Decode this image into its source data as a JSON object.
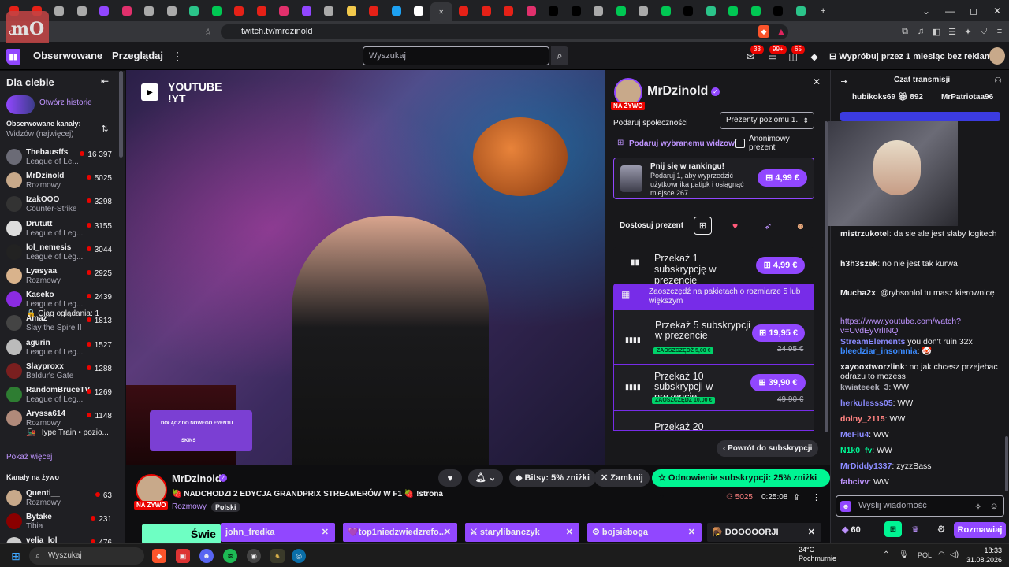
{
  "browser": {
    "url": "twitch.tv/mrdzinold",
    "tab_colors": [
      "#e62117",
      "#e62117",
      "#aaaaaa",
      "#aaaaaa",
      "#9146ff",
      "#e1306c",
      "#aaaaaa",
      "#aaaaaa",
      "#2bc48a",
      "#00c853",
      "#e62117",
      "#e62117",
      "#e1306c",
      "#9146ff",
      "#aaaaaa",
      "#f2c94c",
      "#e62117",
      "#1da1f2",
      "#ffffff",
      "#e1306c",
      "#e62117",
      "#e62117",
      "#e62117",
      "#e1306c",
      "#000000",
      "#000000",
      "#aaaaaa",
      "#00c853",
      "#aaaaaa",
      "#00c853",
      "#000000",
      "#2bc48a",
      "#00c853",
      "#00c853",
      "#000000",
      "#2bc48a"
    ],
    "active_tab_index": 19
  },
  "twitch": {
    "nav": {
      "followed": "Obserwowane",
      "browse": "Przeglądaj"
    },
    "search_placeholder": "Wyszukaj",
    "badges": {
      "drops": "33",
      "notifications": "99+",
      "whispers": "65"
    },
    "turbo_promo": "Wypróbuj przez 1 miesiąc bez reklam"
  },
  "sidebar": {
    "title": "Dla ciebie",
    "stories": "Otwórz historie",
    "followed_header": "Obserwowane kanały:",
    "sort": "Widzów (najwięcej)",
    "followed": [
      {
        "name": "Thebausffs",
        "game": "League of Le...",
        "viewers": "16 397",
        "color": "#6b6b76"
      },
      {
        "name": "MrDzinold",
        "game": "Rozmowy",
        "viewers": "5025",
        "color": "#c8a98a"
      },
      {
        "name": "IzakOOO",
        "game": "Counter-Strike",
        "viewers": "3298",
        "color": "#333333"
      },
      {
        "name": "Drututt",
        "game": "League of Leg...",
        "viewers": "3155",
        "color": "#dddddd"
      },
      {
        "name": "lol_nemesis",
        "game": "League of Leg...",
        "viewers": "3044",
        "color": "#222222"
      },
      {
        "name": "Lyasyaa",
        "game": "Rozmowy",
        "viewers": "2925",
        "color": "#d9b38c"
      },
      {
        "name": "Kaseko",
        "game": "League of Leg...",
        "extra": "🔒 Ciąg oglądania: 1",
        "viewers": "2439",
        "color": "#8a2be2"
      },
      {
        "name": "Amaz",
        "game": "Slay the Spire II",
        "viewers": "1813",
        "color": "#444444"
      },
      {
        "name": "agurin",
        "game": "League of Leg...",
        "viewers": "1527",
        "color": "#bbbbbb"
      },
      {
        "name": "Slayproxx",
        "game": "Baldur's Gate",
        "viewers": "1288",
        "color": "#7a1f1f"
      },
      {
        "name": "RandomBruceTV",
        "game": "League of Leg...",
        "viewers": "1269",
        "color": "#2e7d32"
      },
      {
        "name": "Aryssa614",
        "game": "Rozmowy",
        "extra": "🚂 Hype Train • pozio...",
        "viewers": "1148",
        "color": "#b08a7a"
      }
    ],
    "show_more": "Pokaż więcej",
    "live_header": "Kanały na żywo",
    "live": [
      {
        "name": "Quenti__",
        "game": "Rozmowy",
        "viewers": "63",
        "color": "#c8a98a"
      },
      {
        "name": "Bytake",
        "game": "Tibia",
        "viewers": "231",
        "color": "#8b0000"
      },
      {
        "name": "velia_lol",
        "game": "",
        "viewers": "476",
        "color": "#cccccc"
      }
    ]
  },
  "video": {
    "overlay_youtube": "YOUTUBE",
    "overlay_handle": "!YT",
    "overlay_event": "DOŁĄCZ DO NOWEGO EVENTU",
    "overlay_brand": "SKINS"
  },
  "gift": {
    "channel": "MrDzinold",
    "live": "NA ŻYWO",
    "community": "Podaruj społeczności",
    "tier": "Prezenty poziomu 1.",
    "gift_viewer": "Podaruj wybranemu widzowi",
    "anonymous": "Anonimowy prezent",
    "ranking": {
      "title": "Pnij się w rankingu!",
      "text": "Podaruj 1, aby wyprzedzić użytkownika patipk i osiągnąć miejsce 267",
      "price": "4,99 €"
    },
    "customize": "Dostosuj prezent",
    "bundle_banner": "Zaoszczędź na pakietach o rozmiarze 5 lub większym",
    "options": [
      {
        "label": "Przekaż 1 subskrypcję w prezencie",
        "price": "4,99 €"
      },
      {
        "label": "Przekaż 5 subskrypcji w prezencie",
        "price": "19,95 €",
        "old_price": "24,95 €",
        "save": "ZAOSZCZĘDŹ 5,00 €"
      },
      {
        "label": "Przekaż 10 subskrypcji w prezencie",
        "price": "39,90 €",
        "old_price": "49,90 €",
        "save": "ZAOSZCZĘDŹ 10,00 €"
      },
      {
        "label": "Przekaż 20"
      }
    ],
    "back": "Powrót do subskrypcji"
  },
  "stream": {
    "name": "MrDzinold",
    "live": "NA ŻYWO",
    "title": "🍓 NADCHODZI 2 EDYCJA GRANDPRIX STREAMERÓW W F1 🍓 !strona",
    "category": "Rozmowy",
    "language": "Polski",
    "bits": "Bitsy: 5% zniżki",
    "close": "Zamknij",
    "resub": "Odnowienie subskrypcji: 25% zniżki",
    "viewers": "5025",
    "uptime": "0:25:08"
  },
  "tabs": {
    "event": "Świe",
    "pinned": [
      {
        "label": "john_fredka",
        "color": "#9147ff"
      },
      {
        "label": "💜top1niedzwiedzrefo...",
        "color": "#9147ff"
      },
      {
        "label": "⚔ starylibanczyk",
        "color": "#9147ff"
      },
      {
        "label": "⚙ bojsieboga",
        "color": "#9147ff"
      },
      {
        "label": "🪤 DOOOOORJI",
        "color": "#1f1f23"
      }
    ]
  },
  "chat": {
    "title": "Czat transmisji",
    "top": [
      {
        "name": "hubikoks69",
        "count": "892"
      },
      {
        "name": "MrPatriotaa96"
      }
    ],
    "lines": [
      {
        "user": "mistrzukotel",
        "color": "#efeff1",
        "text": ": da sie ale jest słaby logitech"
      },
      {
        "user": "h3h3szek",
        "color": "#efeff1",
        "text": ": no nie jest tak kurwa"
      },
      {
        "user": "Mucha2x",
        "color": "#efeff1",
        "text": ": @rybsonlol tu masz kierownicę"
      },
      {
        "user": "",
        "color": "#bf94ff",
        "text": "https://www.youtube.com/watch?v=UvdEyVrlINQ"
      },
      {
        "user": "StreamElements",
        "color": "#8b8bff",
        "text": " you don't ruin 32x"
      },
      {
        "user": "bleedziar_insomnia",
        "color": "#3b8bff",
        "text": ": 🤡"
      },
      {
        "user": "xayooxtworzlink",
        "color": "#efeff1",
        "text": ": no jak chcesz przejebac odrazu to mozess"
      },
      {
        "user": "kwiateeek_3",
        "color": "#adadb8",
        "text": ": WW"
      },
      {
        "user": "herkulesss05",
        "color": "#8b8bff",
        "text": ": WW"
      },
      {
        "user": "dolny_2115",
        "color": "#ff8280",
        "text": ": WW"
      },
      {
        "user": "MeFiu4",
        "color": "#8b8bff",
        "text": ": WW"
      },
      {
        "user": "N1k0_fv",
        "color": "#00f593",
        "text": ": WW"
      },
      {
        "user": "MrDiddy1337",
        "color": "#8b8bff",
        "text": ": zyzzBass"
      },
      {
        "user": "fabcivv",
        "color": "#bf94ff",
        "text": ": WW"
      }
    ],
    "placeholder": "Wyślij wiadomość",
    "points": "60",
    "send": "Rozmawiaj"
  },
  "taskbar": {
    "search": "Wyszukaj",
    "temp": "24°C",
    "weather": "Pochmurnie",
    "lang": "POL",
    "time": "18:33",
    "date": "31.08.2026"
  }
}
